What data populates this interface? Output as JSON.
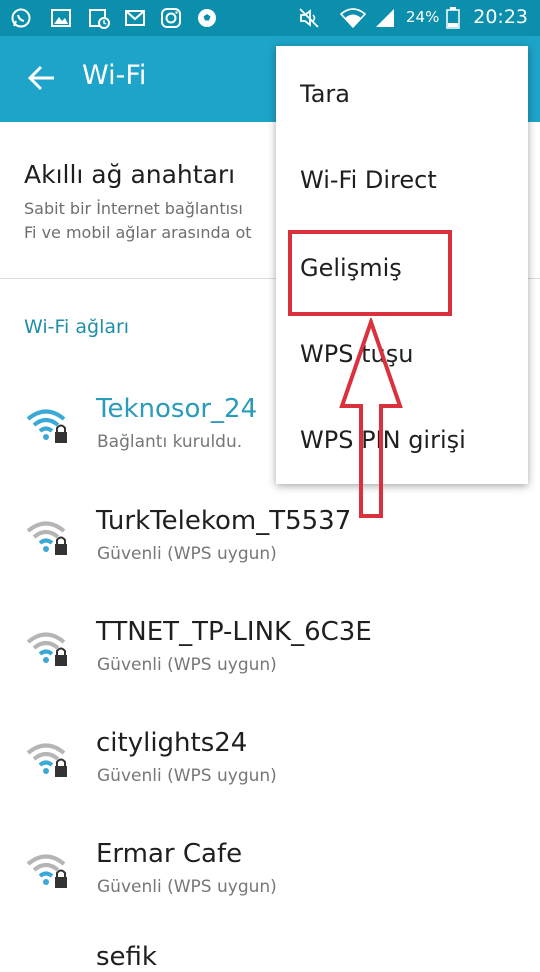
{
  "status_bar": {
    "battery_percent": "24%",
    "time": "20:23",
    "left_icons": [
      "whatsapp-icon",
      "gallery-icon",
      "calendar-icon",
      "gmail-icon",
      "instagram-icon",
      "football-icon"
    ],
    "right_icons": [
      "mute-icon",
      "wifi-icon",
      "signal-icon",
      "battery-icon"
    ]
  },
  "app_bar": {
    "title": "Wi-Fi",
    "color": "#1ea4c9"
  },
  "smart_switch": {
    "title": "Akıllı ağ anahtarı",
    "description": "Sabit bir İnternet bağlantısı\nFi ve mobil ağlar arasında ot"
  },
  "networks_section": {
    "title": "Wi-Fi ağları",
    "networks": [
      {
        "name": "Teknosor_24",
        "status": "Bağlantı kuruldu.",
        "connected": true
      },
      {
        "name": "TurkTelekom_T5537",
        "status": "Güvenli (WPS uygun)",
        "connected": false
      },
      {
        "name": "TTNET_TP-LINK_6C3E",
        "status": "Güvenli (WPS uygun)",
        "connected": false
      },
      {
        "name": "citylights24",
        "status": "Güvenli (WPS uygun)",
        "connected": false
      },
      {
        "name": "Ermar Cafe",
        "status": "Güvenli (WPS uygun)",
        "connected": false
      }
    ],
    "partial_name": "sefik"
  },
  "overflow_menu": {
    "items": [
      "Tara",
      "Wi-Fi Direct",
      "Gelişmiş",
      "WPS tuşu",
      "WPS PIN girişi"
    ],
    "highlighted": "Gelişmiş"
  },
  "colors": {
    "status_bar": "#0b8fad",
    "accent": "#1e8fa8",
    "annotation": "#d9323c"
  }
}
